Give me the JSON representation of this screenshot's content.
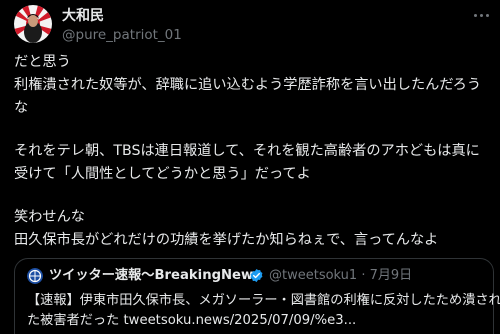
{
  "author": {
    "display_name": "大和民",
    "handle": "@pure_patriot_01",
    "avatar": "rising-sun-profile-avatar"
  },
  "more_icon": "more-horizontal-icon",
  "body": {
    "lines": [
      "だと思う",
      "利権潰された奴等が、辞職に追い込むよう学歴詐称を言い出したんだろう",
      "な",
      "",
      "それをテレ朝、TBSは連日報道して、それを観た高齢者のアホどもは真に",
      "受けて「人間性としてどうかと思う」だってよ",
      "",
      "笑わせんな",
      "田久保市長がどれだけの功績を挙げたか知らねぇで、言ってんなよ"
    ]
  },
  "quote": {
    "display_name": "ツイッター速報〜BreakingNews",
    "verified_icon": "verified-badge-icon",
    "meta": "@tweetsoku1 · 7月9日",
    "lines": [
      "【速報】伊東市田久保市長、メガソーラー・図書館の利権に反対したため潰され",
      "た被害者だった tweetsoku.news/2025/07/09/%e3..."
    ]
  },
  "colors": {
    "background": "#000000",
    "text": "#e7e9ea",
    "secondary": "#71767b",
    "border": "#2f3336",
    "verified": "#1d9bf0"
  }
}
